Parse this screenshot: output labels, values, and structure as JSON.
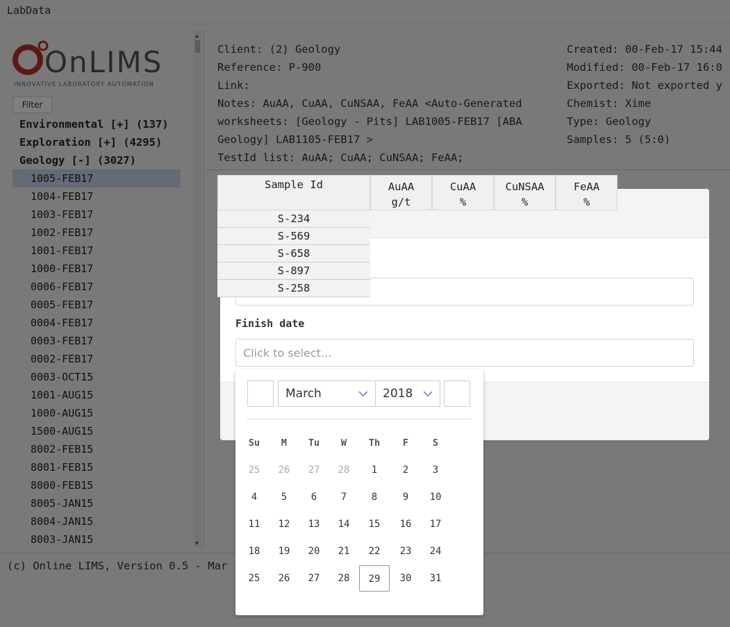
{
  "app": {
    "title": "LabData"
  },
  "logo": {
    "brand": "OnLIMS",
    "tagline": "INNOVATIVE LABORATORY AUTOMATION"
  },
  "sidebar": {
    "filter_label": "Filter",
    "groups": [
      {
        "label": "Environmental [+] (137)"
      },
      {
        "label": "Exploration [+] (4295)"
      },
      {
        "label": "Geology [-] (3027)"
      }
    ],
    "items": [
      "1005-FEB17",
      "1004-FEB17",
      "1003-FEB17",
      "1002-FEB17",
      "1001-FEB17",
      "1000-FEB17",
      "0006-FEB17",
      "0005-FEB17",
      "0004-FEB17",
      "0003-FEB17",
      "0002-FEB17",
      "0003-OCT15",
      "1001-AUG15",
      "1000-AUG15",
      "1500-AUG15",
      "8002-FEB15",
      "8001-FEB15",
      "8000-FEB15",
      "8005-JAN15",
      "8004-JAN15",
      "8003-JAN15"
    ],
    "selected_index": 0
  },
  "details": {
    "client": "Client: (2) Geology",
    "reference": "Reference: P-900",
    "link": "Link:",
    "notes_line1": "Notes: AuAA, CuAA, CuNSAA, FeAA  <Auto-Generated",
    "notes_line2": "worksheets: [Geology - Pits] LAB1005-FEB17 [ABA",
    "notes_line3": "Geology] LAB1105-FEB17 >",
    "testids": "TestId list: AuAA; CuAA; CuNSAA; FeAA;",
    "created": "Created: 00-Feb-17 15:44",
    "modified": "Modified: 00-Feb-17 16:0",
    "exported": "Exported: Not exported y",
    "chemist": "Chemist: Xime",
    "type": "Type: Geology",
    "samples": "Samples: 5 (5:0)"
  },
  "sample_table": {
    "headers": [
      {
        "name": "Sample Id",
        "unit": ""
      },
      {
        "name": "AuAA",
        "unit": "g/t"
      },
      {
        "name": "CuAA",
        "unit": "%"
      },
      {
        "name": "CuNSAA",
        "unit": "%"
      },
      {
        "name": "FeAA",
        "unit": "%"
      }
    ],
    "rows": [
      "S-234",
      "S-569",
      "S-658",
      "S-897",
      "S-258"
    ]
  },
  "modal": {
    "finish_label": "Finish date",
    "finish_placeholder": "Click to select..."
  },
  "datepicker": {
    "month": "March",
    "year": "2018",
    "weekdays": [
      "Su",
      "M",
      "Tu",
      "W",
      "Th",
      "F",
      "S"
    ],
    "weeks": [
      [
        "25",
        "26",
        "27",
        "28",
        "1",
        "2",
        "3"
      ],
      [
        "4",
        "5",
        "6",
        "7",
        "8",
        "9",
        "10"
      ],
      [
        "11",
        "12",
        "13",
        "14",
        "15",
        "16",
        "17"
      ],
      [
        "18",
        "19",
        "20",
        "21",
        "22",
        "23",
        "24"
      ],
      [
        "25",
        "26",
        "27",
        "28",
        "29",
        "30",
        "31"
      ]
    ],
    "muted_in_first_week": 4,
    "highlighted_day": "29"
  },
  "footer": {
    "text": "(c) Online LIMS, Version 0.5 - Mar"
  },
  "colors": {
    "accent": "#8c8cd8",
    "logo_red": "#b8312a",
    "selection": "#c8d7e8"
  }
}
